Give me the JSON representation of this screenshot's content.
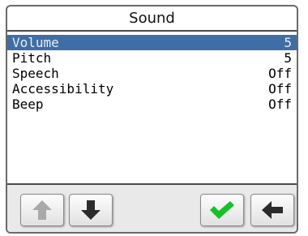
{
  "title": "Sound",
  "items": [
    {
      "label": "Volume",
      "value": "5",
      "selected": true
    },
    {
      "label": "Pitch",
      "value": "5",
      "selected": false
    },
    {
      "label": "Speech",
      "value": "Off",
      "selected": false
    },
    {
      "label": "Accessibility",
      "value": "Off",
      "selected": false
    },
    {
      "label": "Beep",
      "value": "Off",
      "selected": false
    }
  ],
  "toolbar": {
    "up_icon": "arrow-up-icon",
    "down_icon": "arrow-down-icon",
    "ok_icon": "checkmark-icon",
    "back_icon": "arrow-left-icon",
    "up_disabled": true
  },
  "colors": {
    "selection": "#3f6ea4",
    "check": "#18c028"
  }
}
